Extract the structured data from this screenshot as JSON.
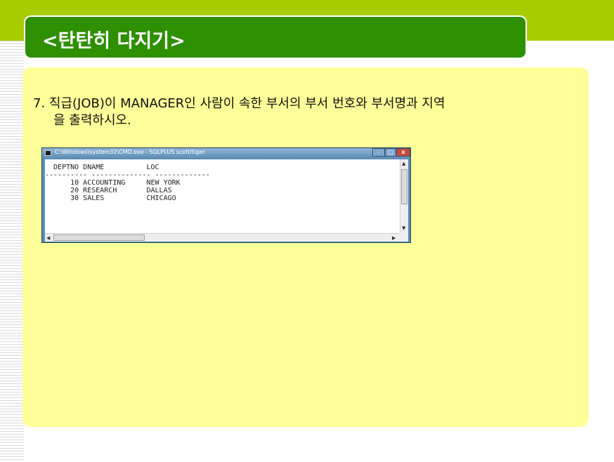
{
  "slide": {
    "title": "<탄탄히 다지기>",
    "question_line1": "7. 직급(JOB)이 MANAGER인 사람이 속한 부서의 부서 번호와 부서명과 지역",
    "question_line2": "을 출력하시오."
  },
  "cmd_window": {
    "title": "C:\\Windows\\system32\\CMD.exe - SQLPLUS  scott/tiger",
    "buttons": {
      "minimize": "–",
      "maximize": "□",
      "close": "x"
    },
    "output": "  DEPTNO DNAME          LOC\n---------- -------------- -------------\n      10 ACCOUNTING     NEW YORK\n      20 RESEARCH       DALLAS\n      30 SALES          CHICAGO",
    "scroll_up": "▲",
    "scroll_down": "▼",
    "scroll_left": "◀",
    "scroll_right": "▶"
  },
  "colors": {
    "top_band": "#a8cc00",
    "title_bg": "#2e8f00",
    "panel_bg": "#ffff99"
  }
}
